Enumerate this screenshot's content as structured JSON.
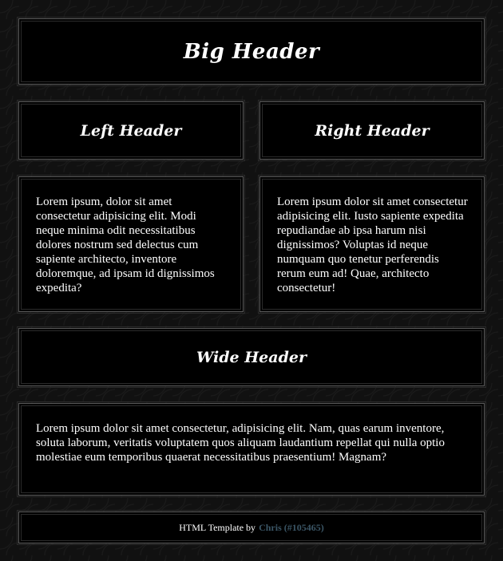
{
  "big_header": "Big Header",
  "left_header": "Left Header",
  "right_header": "Right Header",
  "left_text": "Lorem ipsum, dolor sit amet consectetur adipisicing elit. Modi neque minima odit necessitatibus dolores nostrum sed delectus cum sapiente architecto, inventore doloremque, ad ipsam id dignissimos expedita?",
  "right_text": "Lorem ipsum dolor sit amet consectetur adipisicing elit. Iusto sapiente expedita repudiandae ab ipsa harum nisi dignissimos? Voluptas id neque numquam quo tenetur perferendis rerum eum ad! Quae, architecto consectetur!",
  "wide_header": "Wide Header",
  "wide_text": "Lorem ipsum dolor sit amet consectetur, adipisicing elit. Nam, quas earum inventore, soluta laborum, veritatis voluptatem quos aliquam laudantium repellat qui nulla optio molestiae eum temporibus quaerat necessitatibus praesentium! Magnam?",
  "footer": {
    "prefix": "HTML Template by",
    "author_link": "Chris (#105465)"
  },
  "colors": {
    "background": "#111111",
    "panel": "#000000",
    "border": "#5a5a5a",
    "link": "#3b5666"
  }
}
